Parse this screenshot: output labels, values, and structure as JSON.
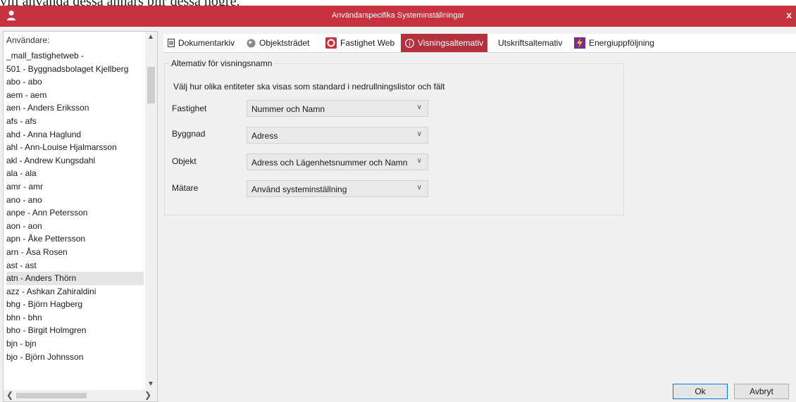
{
  "background_text": "vill använda dessa annars blir dessa högre.",
  "window": {
    "title": "Användarspecifika Systeminställningar",
    "close_label": "x"
  },
  "users": {
    "header": "Användare:",
    "selected_index": 17,
    "items": [
      "_mall_fastighetweb -",
      "501 - Byggnadsbolaget Kjellberg",
      "abo - abo",
      "aem - aem",
      "aen - Anders Eriksson",
      "afs - afs",
      "ahd - Anna Haglund",
      "ahl - Ann-Louise Hjalmarsson",
      "akl - Andrew Kungsdahl",
      "ala - ala",
      "amr - amr",
      "ano - ano",
      "anpe - Ann Petersson",
      "aon - aon",
      "apn - Åke Pettersson",
      "arn - Åsa Rosen",
      "ast - ast",
      "atn - Anders Thörn",
      "azz - Ashkan Zahiraldini",
      "bhg - Björn Hagberg",
      "bhn - bhn",
      "bho - Birgit Holmgren",
      "bjn - bjn",
      "bjo - Björn Johnsson"
    ]
  },
  "tabs": [
    {
      "label": "Dokumentarkiv",
      "icon": "document-icon"
    },
    {
      "label": "Objektsträdet",
      "icon": "globe-icon"
    },
    {
      "label": "Fastighet Web",
      "icon": "fastighet-web-icon"
    },
    {
      "label": "Visningsaltemativ",
      "icon": "info-icon"
    },
    {
      "label": "Utskriftsaltemativ",
      "icon": ""
    },
    {
      "label": "Energiuppföljning",
      "icon": "energy-icon"
    }
  ],
  "active_tab": 3,
  "display_options": {
    "group_title": "Altemativ för visningsnamn",
    "description": "Välj hur olika entiteter ska visas som standard i nedrullningslistor och fält",
    "fields": [
      {
        "label": "Fastighet",
        "value": "Nummer och Namn"
      },
      {
        "label": "Byggnad",
        "value": "Adress"
      },
      {
        "label": "Objekt",
        "value": "Adress och Lägenhetsnummer och Namn"
      },
      {
        "label": "Mätare",
        "value": "Använd systeminställning"
      }
    ]
  },
  "buttons": {
    "ok": "Ok",
    "cancel": "Avbryt"
  },
  "colors": {
    "title_bar": "#c8323f",
    "active_tab": "#b3303c"
  }
}
